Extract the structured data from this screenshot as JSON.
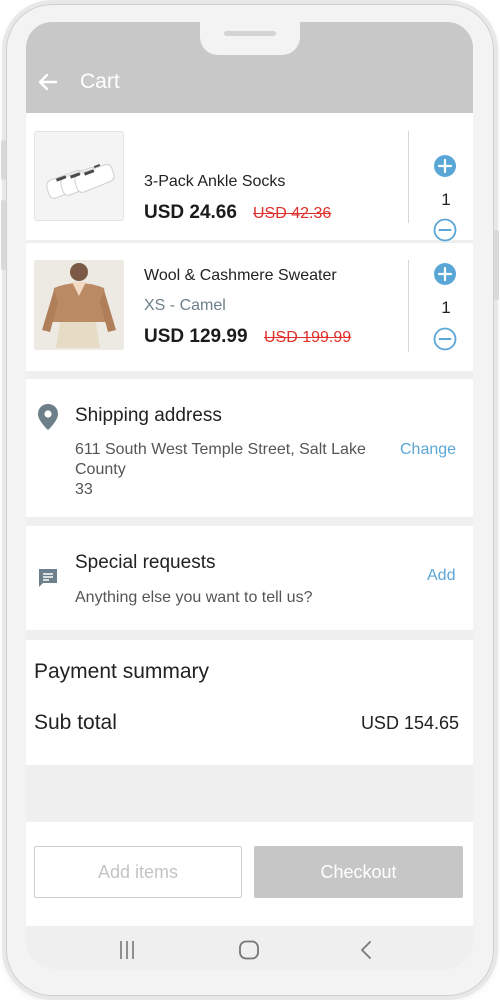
{
  "header": {
    "title": "Cart"
  },
  "cart": {
    "items": [
      {
        "name": "3-Pack Ankle Socks",
        "variant": "",
        "price": "USD 24.66",
        "original_price": "USD 42.36",
        "quantity": "1"
      },
      {
        "name": "Wool & Cashmere Sweater",
        "variant": "XS - Camel",
        "price": "USD 129.99",
        "original_price": "USD 199.99",
        "quantity": "1"
      }
    ]
  },
  "shipping": {
    "title": "Shipping address",
    "address_line1": "611 South West Temple Street, Salt Lake County",
    "address_line2": "33",
    "action": "Change"
  },
  "special_requests": {
    "title": "Special requests",
    "placeholder": "Anything else you want to tell us?",
    "action": "Add"
  },
  "payment": {
    "title": "Payment summary",
    "subtotal_label": "Sub total",
    "subtotal_value": "USD 154.65"
  },
  "actions": {
    "add_items": "Add items",
    "checkout": "Checkout"
  },
  "colors": {
    "accent": "#5aa6d6",
    "strike_price": "#e0302c",
    "header_bg": "#c8c8c8",
    "disabled_button": "#c6c6c6"
  },
  "icons": [
    "back-arrow-icon",
    "plus-circle-icon",
    "minus-circle-icon",
    "location-pin-icon",
    "message-icon",
    "nav-recents-icon",
    "nav-home-icon",
    "nav-back-icon"
  ]
}
